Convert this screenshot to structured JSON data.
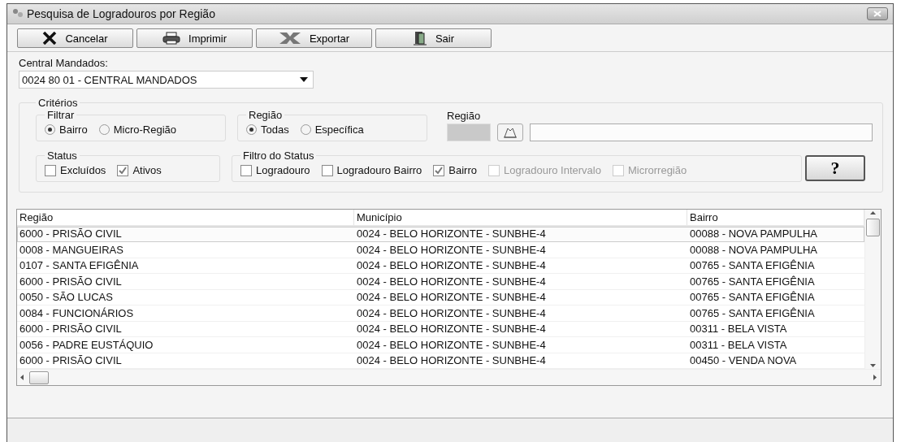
{
  "window": {
    "title": "Pesquisa de Logradouros por Região"
  },
  "toolbar": [
    {
      "label": "Cancelar",
      "kind": "cancel"
    },
    {
      "label": "Imprimir",
      "kind": "print"
    },
    {
      "label": "Exportar",
      "kind": "export"
    },
    {
      "label": "Sair",
      "kind": "exit"
    }
  ],
  "central": {
    "label": "Central Mandados:",
    "value": "0024 80 01 - CENTRAL MANDADOS"
  },
  "criteria": {
    "title": "Critérios",
    "filtrar": {
      "title": "Filtrar",
      "options": [
        {
          "label": "Bairro",
          "selected": true
        },
        {
          "label": "Micro-Região",
          "selected": false
        }
      ]
    },
    "regiao_group": {
      "title": "Região",
      "options": [
        {
          "label": "Todas",
          "selected": true
        },
        {
          "label": "Específica",
          "selected": false
        }
      ]
    },
    "regiao_field": {
      "label": "Região",
      "disabled": true
    },
    "status": {
      "title": "Status",
      "options": [
        {
          "label": "Excluídos",
          "checked": false,
          "disabled": false
        },
        {
          "label": "Ativos",
          "checked": true,
          "disabled": false
        }
      ]
    },
    "filtro_status": {
      "title": "Filtro do Status",
      "options": [
        {
          "label": "Logradouro",
          "checked": false,
          "disabled": false
        },
        {
          "label": "Logradouro Bairro",
          "checked": false,
          "disabled": false
        },
        {
          "label": "Bairro",
          "checked": true,
          "disabled": false
        },
        {
          "label": "Logradouro Intervalo",
          "checked": false,
          "disabled": true
        },
        {
          "label": "Microrregião",
          "checked": false,
          "disabled": true
        }
      ]
    },
    "help_button": {
      "label": "?"
    }
  },
  "table": {
    "columns": [
      "Região",
      "Município",
      "Bairro"
    ],
    "rows": [
      {
        "cells": [
          "6000 - PRISÃO CIVIL",
          "0024 - BELO HORIZONTE - SUNBHE-4",
          "00088 - NOVA PAMPULHA"
        ],
        "selected": true
      },
      {
        "cells": [
          "0008 - MANGUEIRAS",
          "0024 - BELO HORIZONTE - SUNBHE-4",
          "00088 - NOVA PAMPULHA"
        ],
        "selected": false
      },
      {
        "cells": [
          "0107 - SANTA EFIGÊNIA",
          "0024 - BELO HORIZONTE - SUNBHE-4",
          "00765 - SANTA EFIGÊNIA"
        ],
        "selected": false
      },
      {
        "cells": [
          "6000 - PRISÃO CIVIL",
          "0024 - BELO HORIZONTE - SUNBHE-4",
          "00765 - SANTA EFIGÊNIA"
        ],
        "selected": false
      },
      {
        "cells": [
          "0050 - SÃO LUCAS",
          "0024 - BELO HORIZONTE - SUNBHE-4",
          "00765 - SANTA EFIGÊNIA"
        ],
        "selected": false
      },
      {
        "cells": [
          "0084 - FUNCIONÁRIOS",
          "0024 - BELO HORIZONTE - SUNBHE-4",
          "00765 - SANTA EFIGÊNIA"
        ],
        "selected": false
      },
      {
        "cells": [
          "6000 - PRISÃO CIVIL",
          "0024 - BELO HORIZONTE - SUNBHE-4",
          "00311 - BELA VISTA"
        ],
        "selected": false
      },
      {
        "cells": [
          "0056 - PADRE EUSTÁQUIO",
          "0024 - BELO HORIZONTE - SUNBHE-4",
          "00311 - BELA VISTA"
        ],
        "selected": false
      },
      {
        "cells": [
          "6000 - PRISÃO CIVIL",
          "0024 - BELO HORIZONTE - SUNBHE-4",
          "00450 - VENDA NOVA"
        ],
        "selected": false
      }
    ]
  }
}
